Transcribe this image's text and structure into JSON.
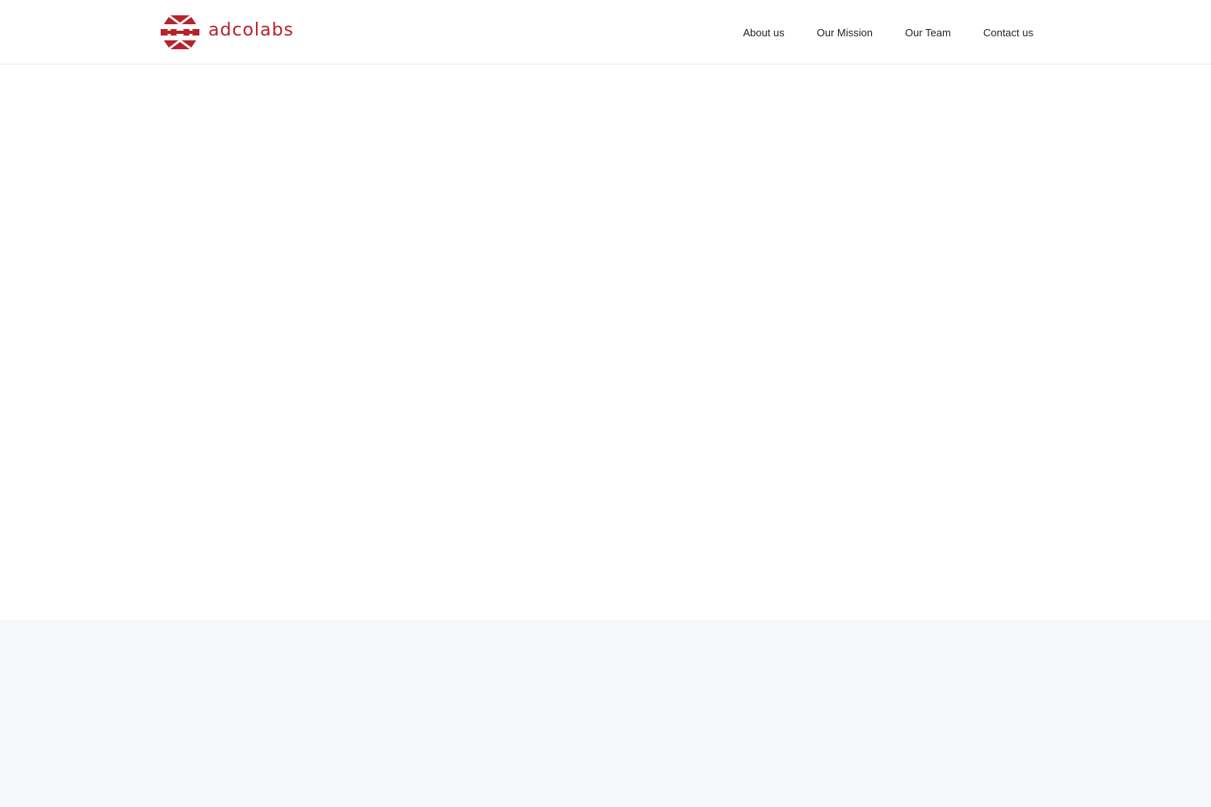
{
  "brand": {
    "name": "adcolabs",
    "color": "#b5232b",
    "logo_icon": "hexagon-triangles-logo-icon"
  },
  "nav": {
    "items": [
      {
        "label": "About us"
      },
      {
        "label": "Our Mission"
      },
      {
        "label": "Our Team"
      },
      {
        "label": "Contact us"
      }
    ]
  },
  "colors": {
    "page_background": "#ffffff",
    "lower_section_background": "#f7f8fa",
    "nav_text": "#212529"
  }
}
